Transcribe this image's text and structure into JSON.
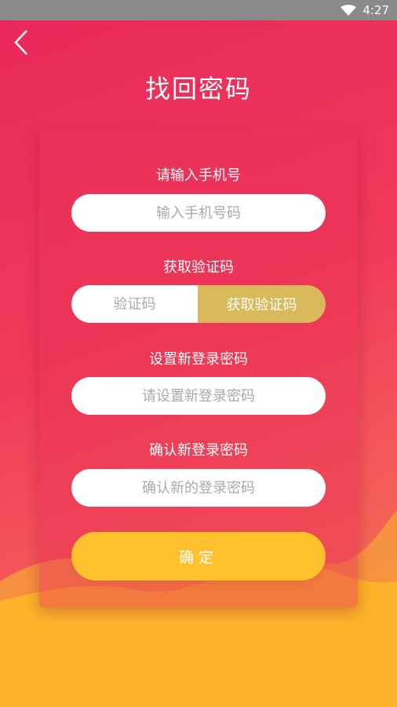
{
  "status_bar": {
    "time": "4:27",
    "wifi_icon": "wifi-icon"
  },
  "header": {
    "title": "找回密码",
    "back_icon": "chevron-left-icon"
  },
  "form": {
    "phone": {
      "label": "请输入手机号",
      "placeholder": "输入手机号码",
      "value": ""
    },
    "code": {
      "label": "获取验证码",
      "placeholder": "验证码",
      "value": "",
      "button_label": "获取验证码"
    },
    "new_password": {
      "label": "设置新登录密码",
      "placeholder": "请设置新登录密码",
      "value": ""
    },
    "confirm_password": {
      "label": "确认新登录密码",
      "placeholder": "确认新的登录密码",
      "value": ""
    },
    "submit_label": "确定"
  },
  "colors": {
    "background_top": "#e8285a",
    "background_bottom": "#f47a4a",
    "code_button": "#d9b95a",
    "submit_button": "#ffc12e",
    "wave": "#fbb42a"
  }
}
